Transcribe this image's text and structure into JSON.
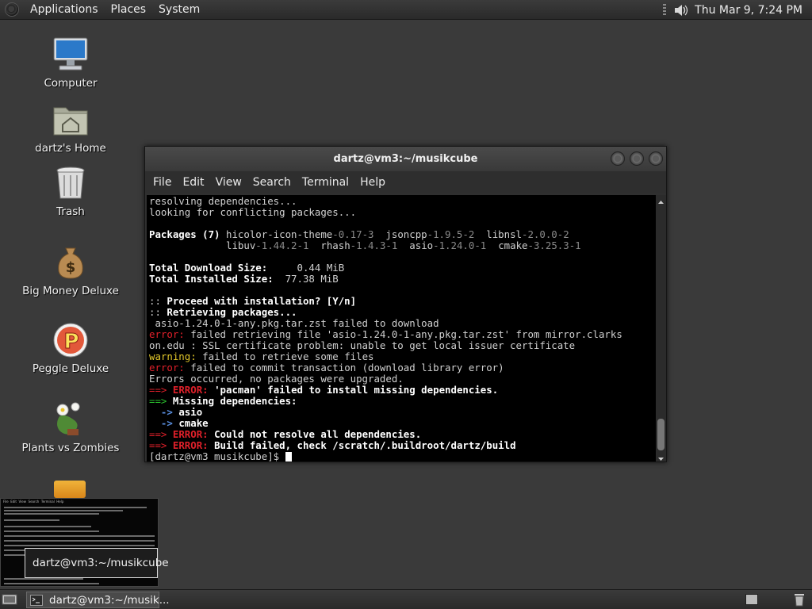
{
  "top_panel": {
    "menus": [
      "Applications",
      "Places",
      "System"
    ],
    "clock": "Thu Mar  9,  7:24 PM"
  },
  "desktop": {
    "icons": [
      {
        "label": "Computer",
        "icon": "computer-icon"
      },
      {
        "label": "dartz's Home",
        "icon": "home-folder-icon"
      },
      {
        "label": "Trash",
        "icon": "trash-icon"
      },
      {
        "label": "Big Money Deluxe",
        "icon": "money-bag-icon"
      },
      {
        "label": "Peggle Deluxe",
        "icon": "peggle-icon"
      },
      {
        "label": "Plants vs Zombies",
        "icon": "plants-vs-zombies-icon"
      }
    ]
  },
  "terminal": {
    "title": "dartz@vm3:~/musikcube",
    "menu": [
      "File",
      "Edit",
      "View",
      "Search",
      "Terminal",
      "Help"
    ],
    "lines": {
      "l1": "resolving dependencies...",
      "l2": "looking for conflicting packages...",
      "pkg_label": "Packages (7) ",
      "pkg1_name": "hicolor-icon-theme",
      "pkg1_ver": "-0.17-3",
      "pkg2_name": "jsoncpp",
      "pkg2_ver": "-1.9.5-2",
      "pkg3_name": "libnsl",
      "pkg3_ver": "-2.0.0-2",
      "pkg4_name": "libuv",
      "pkg4_ver": "-1.44.2-1",
      "pkg5_name": "rhash",
      "pkg5_ver": "-1.4.3-1",
      "pkg6_name": "asio",
      "pkg6_ver": "-1.24.0-1",
      "pkg7_name": "cmake",
      "pkg7_ver": "-3.25.3-1",
      "dl_label": "Total Download Size:",
      "dl_value": "0.44 MiB",
      "inst_label": "Total Installed Size:",
      "inst_value": "77.38 MiB",
      "proceed_prefix": "::",
      "proceed": "Proceed with installation? [Y/n]",
      "retrieving_prefix": "::",
      "retrieving": "Retrieving packages...",
      "fail_download": "asio-1.24.0-1-any.pkg.tar.zst failed to download",
      "error_word": "error:",
      "err1_a": "failed retrieving file 'asio-1.24.0-1-any.pkg.tar.zst' from mirror.clarks",
      "err1_b": "on.edu : SSL certificate problem: unable to get local issuer certificate",
      "warning_word": "warning:",
      "warn1": "failed to retrieve some files",
      "err2": "failed to commit transaction (download library error)",
      "errors_occurred": "Errors occurred, no packages were upgraded.",
      "arrow": "==>",
      "error_caps": "ERROR:",
      "e1": "'pacman' failed to install missing dependencies.",
      "missing": "Missing dependencies:",
      "sub_arrow": "->",
      "dep1": "asio",
      "dep2": "cmake",
      "e2": "Could not resolve all dependencies.",
      "e3": "Build failed, check /scratch/.buildroot/dartz/build",
      "prompt": "[dartz@vm3 musikcube]$ "
    }
  },
  "preview": {
    "label": "dartz@vm3:~/musikcube",
    "mini_menu": "File  Edit  View  Search  Terminal  Help"
  },
  "taskbar": {
    "task_label": "dartz@vm3:~/musik..."
  },
  "colors": {
    "error": "#e0202a",
    "success_arrow": "#2ac12e",
    "warning": "#e3c82a"
  }
}
